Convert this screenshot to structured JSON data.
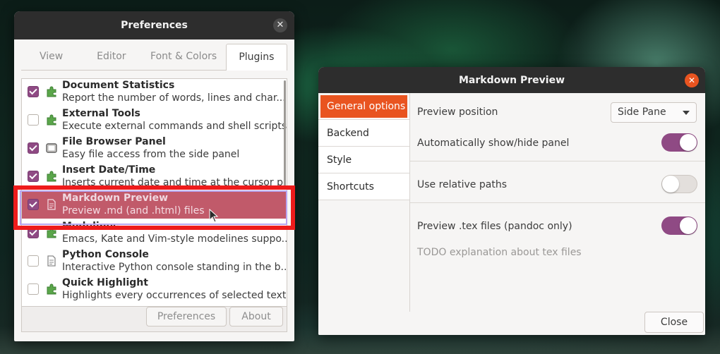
{
  "preferences": {
    "title": "Preferences",
    "tabs": [
      {
        "label": "View"
      },
      {
        "label": "Editor"
      },
      {
        "label": "Font & Colors"
      },
      {
        "label": "Plugins"
      }
    ],
    "plugins": [
      {
        "name": "Document Statistics",
        "desc": "Report the number of words, lines and char...",
        "checked": true,
        "icon": "puzzle-icon"
      },
      {
        "name": "External Tools",
        "desc": "Execute external commands and shell scripts.",
        "checked": false,
        "icon": "puzzle-icon"
      },
      {
        "name": "File Browser Panel",
        "desc": "Easy file access from the side panel",
        "checked": true,
        "icon": "panel-icon"
      },
      {
        "name": "Insert Date/Time",
        "desc": "Inserts current date and time at the cursor p...",
        "checked": true,
        "icon": "puzzle-icon"
      },
      {
        "name": "Markdown Preview",
        "desc": "Preview .md (and .html) files",
        "checked": true,
        "icon": "document-icon",
        "selected": true
      },
      {
        "name": "Modelines",
        "desc": "Emacs, Kate and Vim-style modelines suppo...",
        "checked": true,
        "icon": "puzzle-icon"
      },
      {
        "name": "Python Console",
        "desc": "Interactive Python console standing in the b...",
        "checked": false,
        "icon": "document-icon"
      },
      {
        "name": "Quick Highlight",
        "desc": "Highlights every occurrences of selected text.",
        "checked": false,
        "icon": "puzzle-icon"
      }
    ],
    "buttons": {
      "preferences": "Preferences",
      "about": "About"
    }
  },
  "markdown_preview": {
    "title": "Markdown Preview",
    "sidebar": [
      {
        "label": "General options"
      },
      {
        "label": "Backend"
      },
      {
        "label": "Style"
      },
      {
        "label": "Shortcuts"
      }
    ],
    "options": {
      "preview_position_label": "Preview position",
      "preview_position_value": "Side Pane",
      "auto_show_label": "Automatically show/hide panel",
      "auto_show_on": true,
      "relative_paths_label": "Use relative paths",
      "relative_paths_on": false,
      "tex_label": "Preview .tex files (pandoc only)",
      "tex_on": true,
      "tex_note": "TODO explanation about tex files"
    },
    "close_label": "Close"
  },
  "colors": {
    "accent_purple": "#8f4a84",
    "ubuntu_orange": "#e95420",
    "selection_red": "#c15a6a",
    "highlight_red": "#ee1b1b"
  }
}
